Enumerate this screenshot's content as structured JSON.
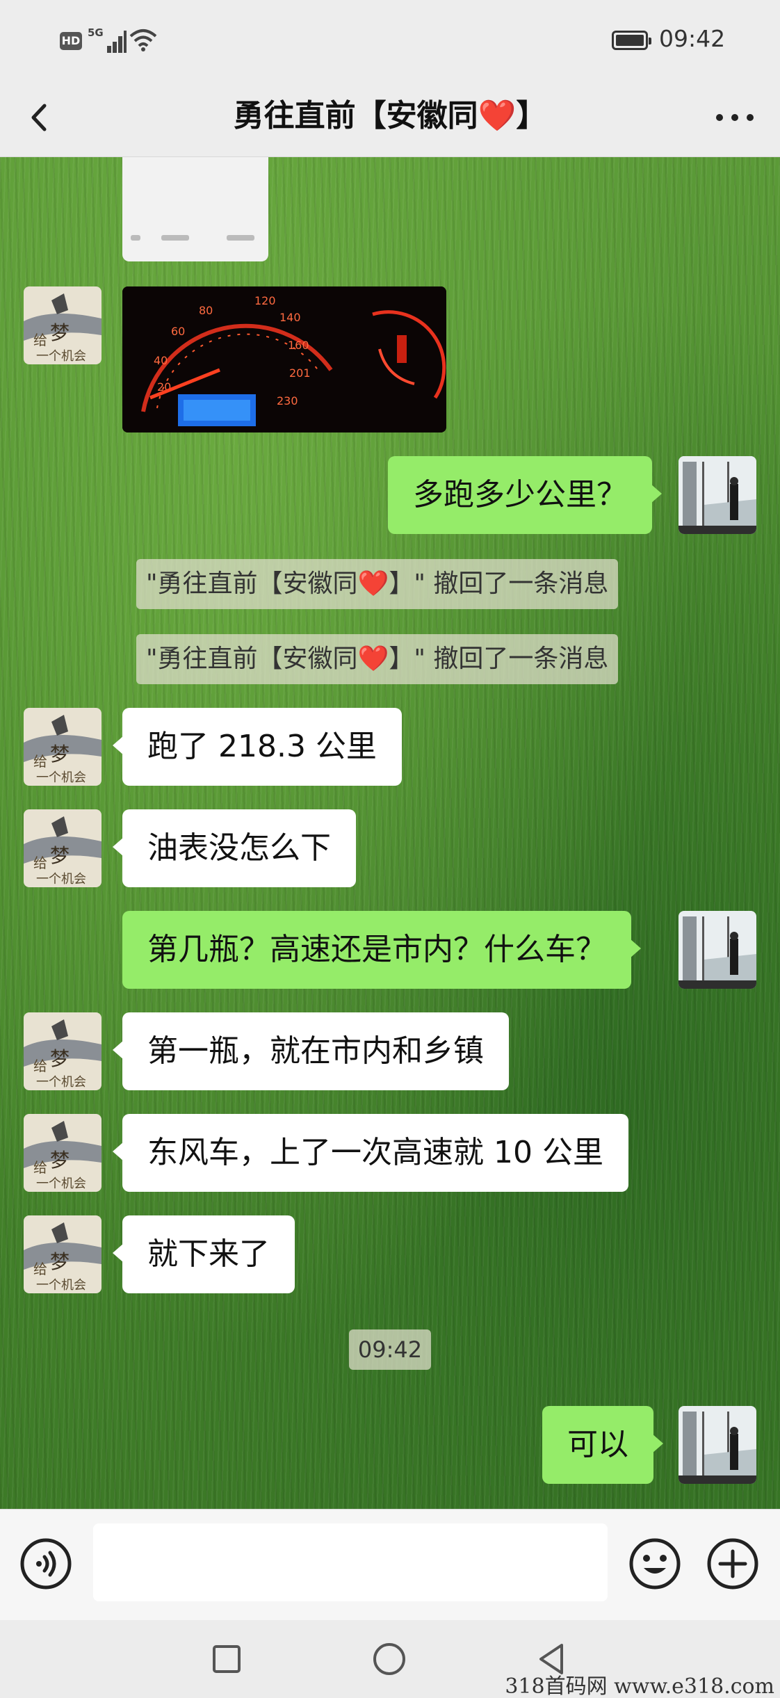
{
  "status_bar": {
    "badge": "HD",
    "network": "5G",
    "time": "09:42"
  },
  "header": {
    "title": "勇往直前【安徽同❤️】",
    "back_icon": "chevron-left-icon",
    "more_icon": "more-dots-icon"
  },
  "messages": [
    {
      "type": "image",
      "side": "left",
      "content": "speedometer dashboard photo"
    },
    {
      "type": "text",
      "side": "right",
      "text": "多跑多少公里？"
    },
    {
      "type": "recall",
      "text": "\"勇往直前【安徽同❤️】\" 撤回了一条消息"
    },
    {
      "type": "recall",
      "text": "\"勇往直前【安徽同❤️】\" 撤回了一条消息"
    },
    {
      "type": "text",
      "side": "left",
      "text": "跑了 218.3 公里"
    },
    {
      "type": "text",
      "side": "left",
      "text": "油表没怎么下"
    },
    {
      "type": "text",
      "side": "right",
      "text": "第几瓶？高速还是市内？什么车？"
    },
    {
      "type": "text",
      "side": "left",
      "text": "第一瓶，就在市内和乡镇"
    },
    {
      "type": "text",
      "side": "left",
      "text": "东风车，上了一次高速就 10 公里"
    },
    {
      "type": "text",
      "side": "left",
      "text": "就下来了"
    },
    {
      "type": "time",
      "text": "09:42"
    },
    {
      "type": "text",
      "side": "right",
      "text": "可以"
    }
  ],
  "input_bar": {
    "voice_icon": "voice-icon",
    "emoji_icon": "emoji-icon",
    "plus_icon": "plus-icon"
  },
  "nav_bar": {
    "icons": [
      "square-icon",
      "circle-icon",
      "triangle-back-icon"
    ]
  },
  "watermark": "318首码网 www.e318.com",
  "colors": {
    "sent_bubble": "#95ec69",
    "received_bubble": "#ffffff",
    "header_bg": "#ededed"
  }
}
